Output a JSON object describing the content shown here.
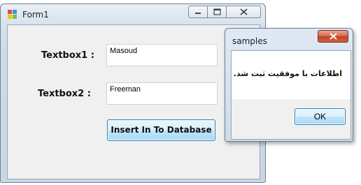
{
  "main_window": {
    "title": "Form1",
    "textbox1_label": "Textbox1 :",
    "textbox1_value": "Masoud",
    "textbox2_label": "Textbox2 :",
    "textbox2_value": "Freeman",
    "insert_button_label": "Insert In To Database",
    "caption_icons": [
      "minimize-icon",
      "maximize-icon",
      "close-icon"
    ]
  },
  "message_box": {
    "title": "samples",
    "message": "اطلاعات با موفقیت ثبت شد.",
    "ok_label": "OK",
    "close_icon": "close-icon"
  },
  "colors": {
    "close_button_red": "#c24026",
    "button_border_blue": "#3c7fb1",
    "client_background": "#f0f0f0"
  }
}
